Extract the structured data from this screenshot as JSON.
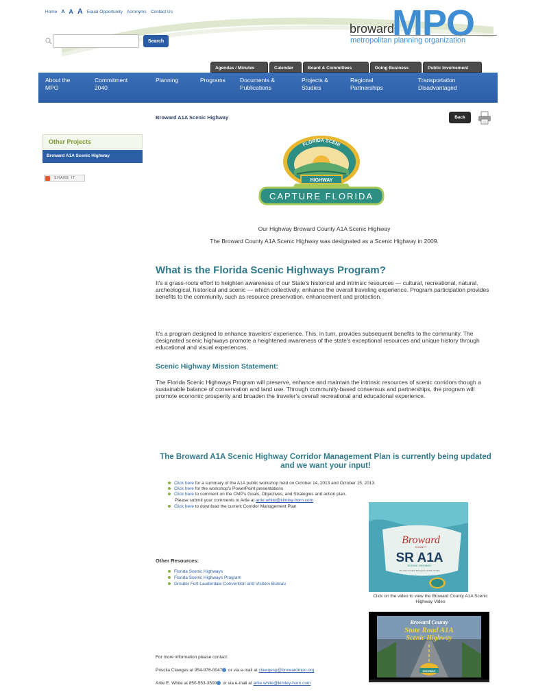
{
  "utility_links": {
    "home": "Home",
    "size_small": "A",
    "size_medium": "A",
    "size_large": "A",
    "equal_opportunity": "Equal Opportunity",
    "acronyms": "Acronyms",
    "contact": "Contact Us"
  },
  "search": {
    "placeholder": "",
    "button": "Search"
  },
  "logo": {
    "broward": "broward",
    "mpo": "MPO",
    "subtitle": "metropolitan planning organization"
  },
  "tabs": [
    "Agendas / Minutes",
    "Calendar",
    "Board & Committees",
    "Doing Business",
    "Public Involvement"
  ],
  "main_nav": [
    {
      "line1": "About the",
      "line2": "MPO"
    },
    {
      "line1": "Commitment",
      "line2": "2040"
    },
    {
      "line1": "Planning",
      "line2": ""
    },
    {
      "line1": "Programs",
      "line2": ""
    },
    {
      "line1": "Documents &",
      "line2": "Publications"
    },
    {
      "line1": "Projects &",
      "line2": "Studies"
    },
    {
      "line1": "Regional",
      "line2": "Partnerships"
    },
    {
      "line1": "Transportation",
      "line2": "Disadvantaged"
    }
  ],
  "breadcrumb": "Broward A1A Scenic Highway",
  "back_button": "Back",
  "sidebar": {
    "heading": "Other Projects",
    "item": "Broward A1A Scenic Highway",
    "share": "SHARE IT"
  },
  "badge": {
    "top": "FLORIDA SCENIC",
    "highway": "HIGHWAY",
    "bottom": "CAPTURE FLORIDA"
  },
  "content": {
    "caption1": "Our Highway Broward County A1A Scenic Highway",
    "caption2": "The Broward County A1A Scenic Highway was designated as a Scenic Highway in 2009.",
    "heading": "What is the Florida Scenic Highways Program?",
    "para1": "It's a grass-roots effort to heighten awareness of our State's historical and intrinsic resources — cultural, recreational, natural, archeological, historical and scenic — which collectively, enhance the overall traveling experience. Program participation provides benefits to the community, such as resource preservation, enhancement and protection.",
    "para2": "It's a program designed to enhance travelers' experience. This, in turn, provides subsequent benefits to the community. The designated scenic highways promote a heightened awareness of the state's exceptional resources and unique history through educational and visual experiences.",
    "mission_heading": "Scenic Highway Mission Statement:",
    "mission": "The Florida Scenic Highways Program will preserve, enhance and maintain the intrinsic resources of scenic corridors though a sustainable balance of conservation and land use. Through community-based consensus and partnerships, the program will promote economic prosperity and broaden the traveler's overall recreational and educational experience.",
    "cmp_heading": "The Broward A1A Scenic Highway Corridor Management Plan is currently being updated and we want your input!",
    "bullets": [
      {
        "link": "Click here",
        "text": " for a summary of the A1A public workshop held on October 14, 2013 and October 15, 2013."
      },
      {
        "link": "Click here",
        "text": " for the workshop's PowerPoint presentations"
      },
      {
        "link": "Click here",
        "text": " to comment on the CMP's Goals, Objectives, and Strategies and action plan."
      },
      {
        "link": "Click here",
        "text": " to download the current Corridor Management Plan"
      }
    ],
    "submit_text": "Please submit your comments to Artie at ",
    "submit_email": "artie.white@kimley-horn.com",
    "resources_heading": "Other Resources:",
    "resources": [
      "Florida Scenic Highways",
      "Florida Scenic Highways Program",
      "Greater Fort Lauderdale Convention and Visitors Bureau"
    ],
    "video_caption": "Click on the video to view the Broward County A1A Scenic Highway Video",
    "contact_intro": "For more information please contact:",
    "contact1_name": "Priscila Clawges at 954-876-0047",
    "contact1_mid": " or via e-mail at ",
    "contact1_email": "clawgesp@browardmpo.org",
    "contact2_name": "Artie E. White at 850-553-3500",
    "contact2_mid": " or via e-mail at ",
    "contact2_email": "artie.white@kimley-horn.com"
  },
  "sraa": {
    "broward": "Broward",
    "county": "COUNTY",
    "title": "SR A1A",
    "scenic": "SCENIC HIGHWAY",
    "sub": "The New Corridor Management Plan Update"
  },
  "video": {
    "line1": "Broward County",
    "line2": "State Road A1A",
    "line3": "Scenic Highway",
    "badge": "HIGHWAY"
  },
  "colors": {
    "brand_blue": "#2c5ea6",
    "logo_blue": "#3f8ed3",
    "heading_teal": "#2f7a8c",
    "bullet_green": "#88b23a"
  }
}
